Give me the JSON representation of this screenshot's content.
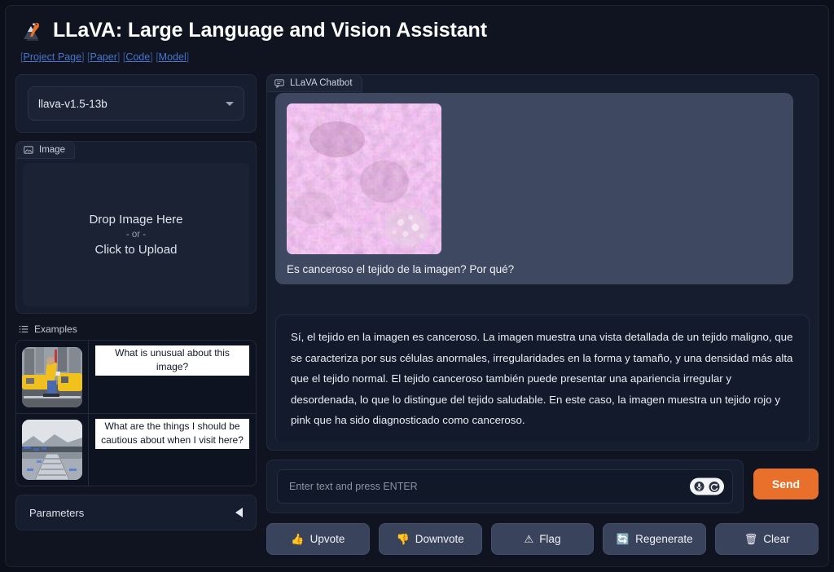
{
  "header": {
    "title": "LLaVA: Large Language and Vision Assistant",
    "logo_icon": "llama-volcano-icon",
    "links": [
      {
        "label": "Project Page"
      },
      {
        "label": "Paper"
      },
      {
        "label": "Code"
      },
      {
        "label": "Model"
      }
    ],
    "bracket_open": "[",
    "bracket_close": "]"
  },
  "sidebar": {
    "model_select": {
      "value": "llava-v1.5-13b",
      "caret_icon": "chevron-down-icon"
    },
    "image_panel": {
      "tab_label": "Image",
      "tab_icon": "image-icon",
      "drop_title": "Drop Image Here",
      "drop_or": "- or -",
      "drop_action": "Click to Upload"
    },
    "examples": {
      "header_label": "Examples",
      "header_icon": "list-icon",
      "rows": [
        {
          "thumb_icon": "taxi-street-thumbnail",
          "caption": "What is unusual about this image?"
        },
        {
          "thumb_icon": "lake-dock-thumbnail",
          "caption": "What are the things I should be cautious about when I visit here?"
        }
      ]
    },
    "parameters": {
      "label": "Parameters",
      "caret_icon": "triangle-left-icon"
    }
  },
  "chat": {
    "tab_label": "LLaVA Chatbot",
    "tab_icon": "chat-bubble-icon",
    "user_message": {
      "image_icon": "histology-tissue-image",
      "text": "Es canceroso el tejido de la imagen? Por qué?"
    },
    "bot_message": {
      "text": "Sí, el tejido en la imagen es canceroso. La imagen muestra una vista detallada de un tejido maligno, que se caracteriza por sus células anormales, irregularidades en la forma y tamaño, y una densidad más alta que el tejido normal. El tejido canceroso también puede presentar una apariencia irregular y desordenada, lo que lo distingue del tejido saludable. En este caso, la imagen muestra un tejido rojo y pink que ha sido diagnosticado como canceroso."
    },
    "input": {
      "value": "",
      "placeholder": "Enter text and press ENTER",
      "mic_icon": "microphone-icon",
      "undo_icon": "refresh-circle-icon"
    },
    "send_button": {
      "label": "Send"
    },
    "actions": [
      {
        "label": "Upvote",
        "icon": "thumbs-up-icon",
        "glyph": "👍"
      },
      {
        "label": "Downvote",
        "icon": "thumbs-down-icon",
        "glyph": "👎"
      },
      {
        "label": "Flag",
        "icon": "warning-triangle-icon",
        "glyph": "⚠"
      },
      {
        "label": "Regenerate",
        "icon": "refresh-icon",
        "glyph": "🔄"
      },
      {
        "label": "Clear",
        "icon": "trash-icon",
        "glyph": "🗑"
      }
    ]
  },
  "colors": {
    "page_bg": "#0b0f19",
    "panel_bg": "#161d2e",
    "user_bubble": "#3f4861",
    "bot_bubble": "#131a2b",
    "accent_orange": "#e8702a",
    "link_blue": "#4a74c9",
    "action_button": "#39435c"
  }
}
